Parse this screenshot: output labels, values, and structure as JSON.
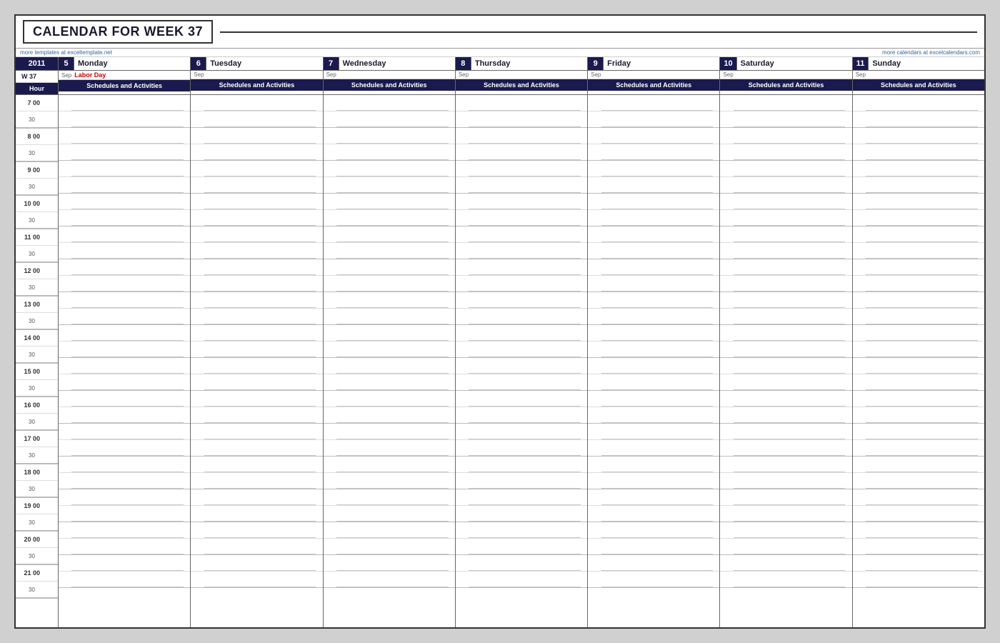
{
  "title": "CALENDAR FOR WEEK 37",
  "links": {
    "left": "more templates at exceltemplate.net",
    "right": "more calendars at excelcalendars.com"
  },
  "year": "2011",
  "week": "W 37",
  "days": [
    {
      "num": "5",
      "name": "Monday",
      "sep": "Sep",
      "holiday": "Labor Day"
    },
    {
      "num": "6",
      "name": "Tuesday",
      "sep": "Sep",
      "holiday": ""
    },
    {
      "num": "7",
      "name": "Wednesday",
      "sep": "Sep",
      "holiday": ""
    },
    {
      "num": "8",
      "name": "Thursday",
      "sep": "Sep",
      "holiday": ""
    },
    {
      "num": "9",
      "name": "Friday",
      "sep": "Sep",
      "holiday": ""
    },
    {
      "num": "10",
      "name": "Saturday",
      "sep": "Sep",
      "holiday": ""
    },
    {
      "num": "11",
      "name": "Sunday",
      "sep": "Sep",
      "holiday": ""
    }
  ],
  "schedules_label": "Schedules and Activities",
  "hour_label": "Hour",
  "hours": [
    {
      "hour": "7 00",
      "half": "30"
    },
    {
      "hour": "8 00",
      "half": "30"
    },
    {
      "hour": "9 00",
      "half": "30"
    },
    {
      "hour": "10 00",
      "half": "30"
    },
    {
      "hour": "11 00",
      "half": "30"
    },
    {
      "hour": "12 00",
      "half": "30"
    },
    {
      "hour": "13 00",
      "half": "30"
    },
    {
      "hour": "14 00",
      "half": "30"
    },
    {
      "hour": "15 00",
      "half": "30"
    },
    {
      "hour": "16 00",
      "half": "30"
    },
    {
      "hour": "17 00",
      "half": "30"
    },
    {
      "hour": "18 00",
      "half": "30"
    },
    {
      "hour": "19 00",
      "half": "30"
    },
    {
      "hour": "20 00",
      "half": "30"
    },
    {
      "hour": "21 00",
      "half": "30"
    }
  ]
}
